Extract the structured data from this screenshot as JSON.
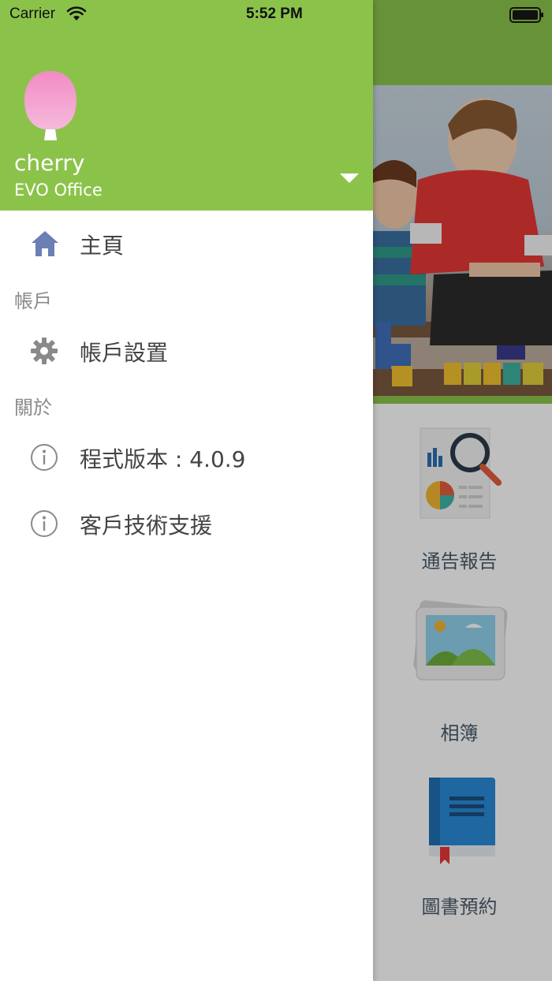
{
  "status_bar": {
    "carrier": "Carrier",
    "time": "5:52 PM",
    "wifi_icon": "wifi-icon",
    "battery_icon": "battery-icon"
  },
  "drawer": {
    "user": {
      "name": "cherry",
      "organization": "EVO Office",
      "avatar_icon": "tree-avatar-icon",
      "toggle_icon": "dropdown-triangle-icon"
    },
    "items": [
      {
        "label": "主頁",
        "icon": "home-icon"
      },
      {
        "label": "帳戶設置",
        "icon": "gear-icon"
      },
      {
        "label": "程式版本 : 4.0.9",
        "icon": "info-icon"
      },
      {
        "label": "客戶技術支援",
        "icon": "info-icon"
      }
    ],
    "sections": {
      "account": "帳戶",
      "about": "關於"
    }
  },
  "main": {
    "features": [
      {
        "label": "通告報告",
        "icon": "report-magnifier-icon"
      },
      {
        "label": "相簿",
        "icon": "photo-album-icon"
      },
      {
        "label": "圖書預約",
        "icon": "book-icon"
      }
    ]
  },
  "colors": {
    "header_green": "#8bc34a",
    "menu_text": "#444444",
    "section_text": "#8a8a8a",
    "home_icon": "#6b7fb5"
  }
}
